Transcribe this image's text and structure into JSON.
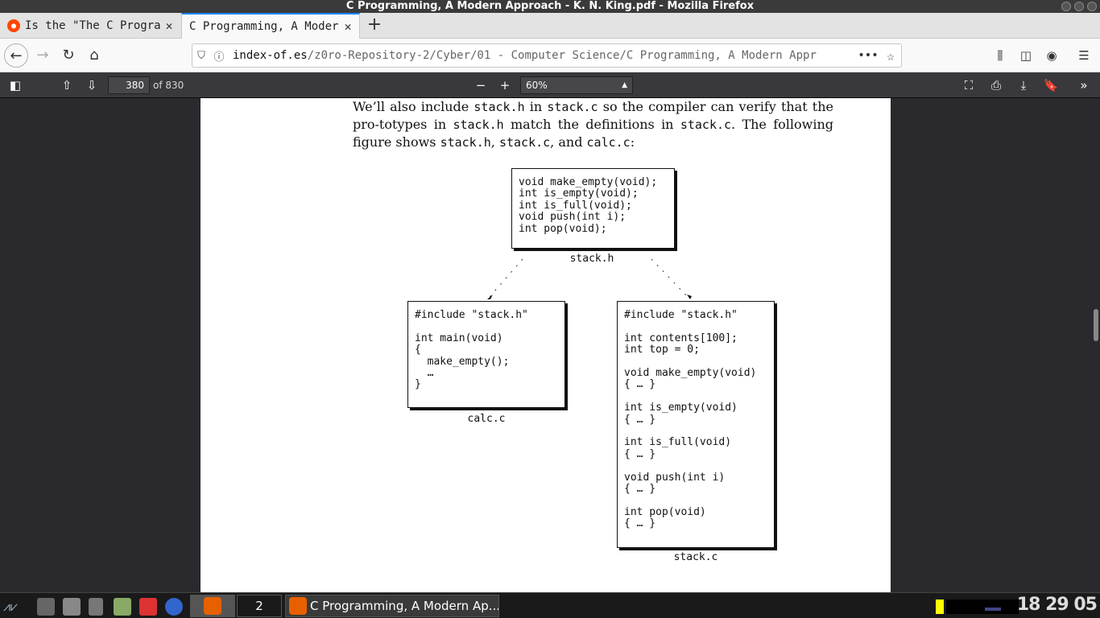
{
  "window": {
    "title": "C Programming, A Modern Approach - K. N. King.pdf - Mozilla Firefox"
  },
  "tabs": [
    {
      "label": "Is the \"The C Progra",
      "active": false
    },
    {
      "label": "C Programming, A Moder",
      "active": true
    }
  ],
  "navbar": {
    "url_domain": "index-of.es",
    "url_path": "/z0ro-Repository-2/Cyber/01 - Computer Science/C Programming, A Modern Appr",
    "more": "•••"
  },
  "pdf_toolbar": {
    "page_number": "380",
    "page_count": "of 830",
    "zoom": "60%",
    "zoom_out": "−",
    "zoom_in": "+"
  },
  "document": {
    "para_parts": [
      "We’ll also include ",
      "stack.h",
      " in ",
      "stack.c",
      " so the compiler can verify that the pro-totypes in ",
      "stack.h",
      " match the definitions in ",
      "stack.c",
      ". The following figure shows ",
      "stack.h",
      ", ",
      "stack.c",
      ", and ",
      "calc.c",
      ":"
    ],
    "stack_h_code": "void make_empty(void);\nint is_empty(void);\nint is_full(void);\nvoid push(int i);\nint pop(void);",
    "stack_h_label": "stack.h",
    "calc_c_code": "#include \"stack.h\"\n\nint main(void)\n{\n  make_empty();\n  …\n}",
    "calc_c_label": "calc.c",
    "stack_c_code": "#include \"stack.h\"\n\nint contents[100];\nint top = 0;\n\nvoid make_empty(void)\n{ … }\n\nint is_empty(void)\n{ … }\n\nint is_full(void)\n{ … }\n\nvoid push(int i)\n{ … }\n\nint pop(void)\n{ … }",
    "stack_c_label": "stack.c"
  },
  "taskbar": {
    "workspace": "2",
    "task_label": "C Programming, A Modern Ap...",
    "clock": "18 29 05"
  },
  "colors": {
    "accent": "#0a84ff",
    "toolbar_dark": "#38383d",
    "reddit": "#ff4500"
  }
}
